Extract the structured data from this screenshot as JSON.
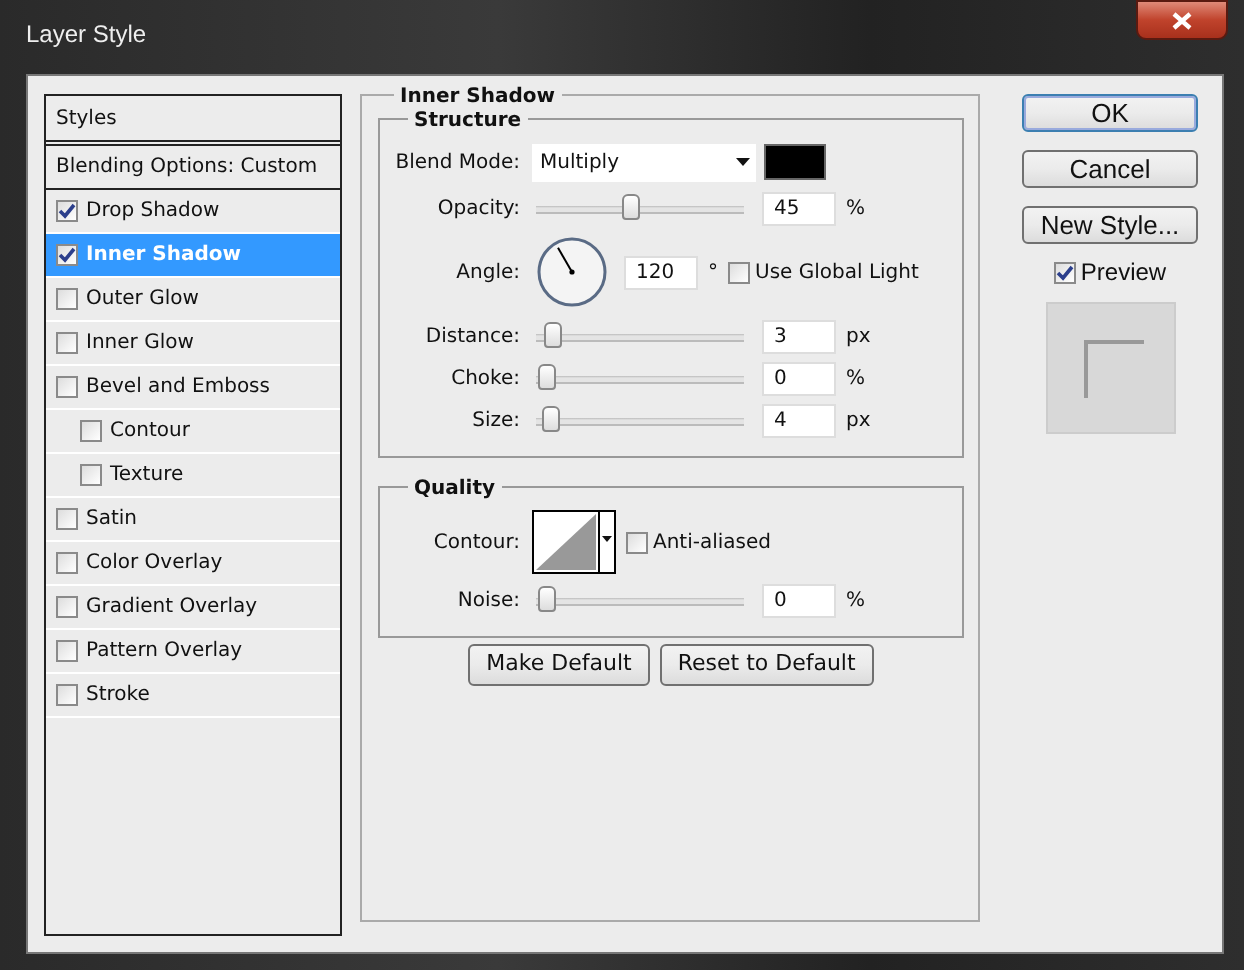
{
  "window": {
    "title": "Layer Style"
  },
  "styles_panel": {
    "header": "Styles",
    "blending_options": "Blending Options: Custom",
    "items": [
      {
        "label": "Drop Shadow",
        "checked": true,
        "selected": false
      },
      {
        "label": "Inner Shadow",
        "checked": true,
        "selected": true
      },
      {
        "label": "Outer Glow",
        "checked": false,
        "selected": false
      },
      {
        "label": "Inner Glow",
        "checked": false,
        "selected": false
      },
      {
        "label": "Bevel and Emboss",
        "checked": false,
        "selected": false,
        "children": [
          {
            "label": "Contour",
            "checked": false,
            "selected": false
          },
          {
            "label": "Texture",
            "checked": false,
            "selected": false
          }
        ]
      },
      {
        "label": "Satin",
        "checked": false,
        "selected": false
      },
      {
        "label": "Color Overlay",
        "checked": false,
        "selected": false
      },
      {
        "label": "Gradient Overlay",
        "checked": false,
        "selected": false
      },
      {
        "label": "Pattern Overlay",
        "checked": false,
        "selected": false
      },
      {
        "label": "Stroke",
        "checked": false,
        "selected": false
      }
    ]
  },
  "section": {
    "title": "Inner Shadow",
    "structure": {
      "title": "Structure",
      "blend_mode": {
        "label": "Blend Mode:",
        "value": "Multiply"
      },
      "rows": [
        {
          "kind": "slider",
          "label": "Opacity:",
          "level": 0.45,
          "value": "45",
          "unit": "%"
        },
        {
          "kind": "angle",
          "label": "Angle:",
          "value": "120",
          "unit": "°",
          "option": {
            "label": "Use Global Light",
            "checked": false
          }
        },
        {
          "kind": "slider",
          "label": "Distance:",
          "level": 0.03,
          "value": "3",
          "unit": "px"
        },
        {
          "kind": "slider",
          "label": "Choke:",
          "level": 0,
          "value": "0",
          "unit": "%"
        },
        {
          "kind": "slider",
          "label": "Size:",
          "level": 0.02,
          "value": "4",
          "unit": "px"
        }
      ]
    },
    "quality": {
      "title": "Quality",
      "contour": {
        "label": "Contour:"
      },
      "anti_aliased": {
        "label": "Anti-aliased",
        "checked": false
      },
      "noise": {
        "label": "Noise:",
        "level": 0,
        "value": "0",
        "unit": "%"
      }
    },
    "buttons": [
      "Make Default",
      "Reset to Default"
    ]
  },
  "actions": [
    {
      "label": "OK",
      "default": true
    },
    {
      "label": "Cancel",
      "default": false
    },
    {
      "label": "New Style...",
      "default": false
    }
  ],
  "preview": {
    "label": "Preview",
    "checked": true
  }
}
